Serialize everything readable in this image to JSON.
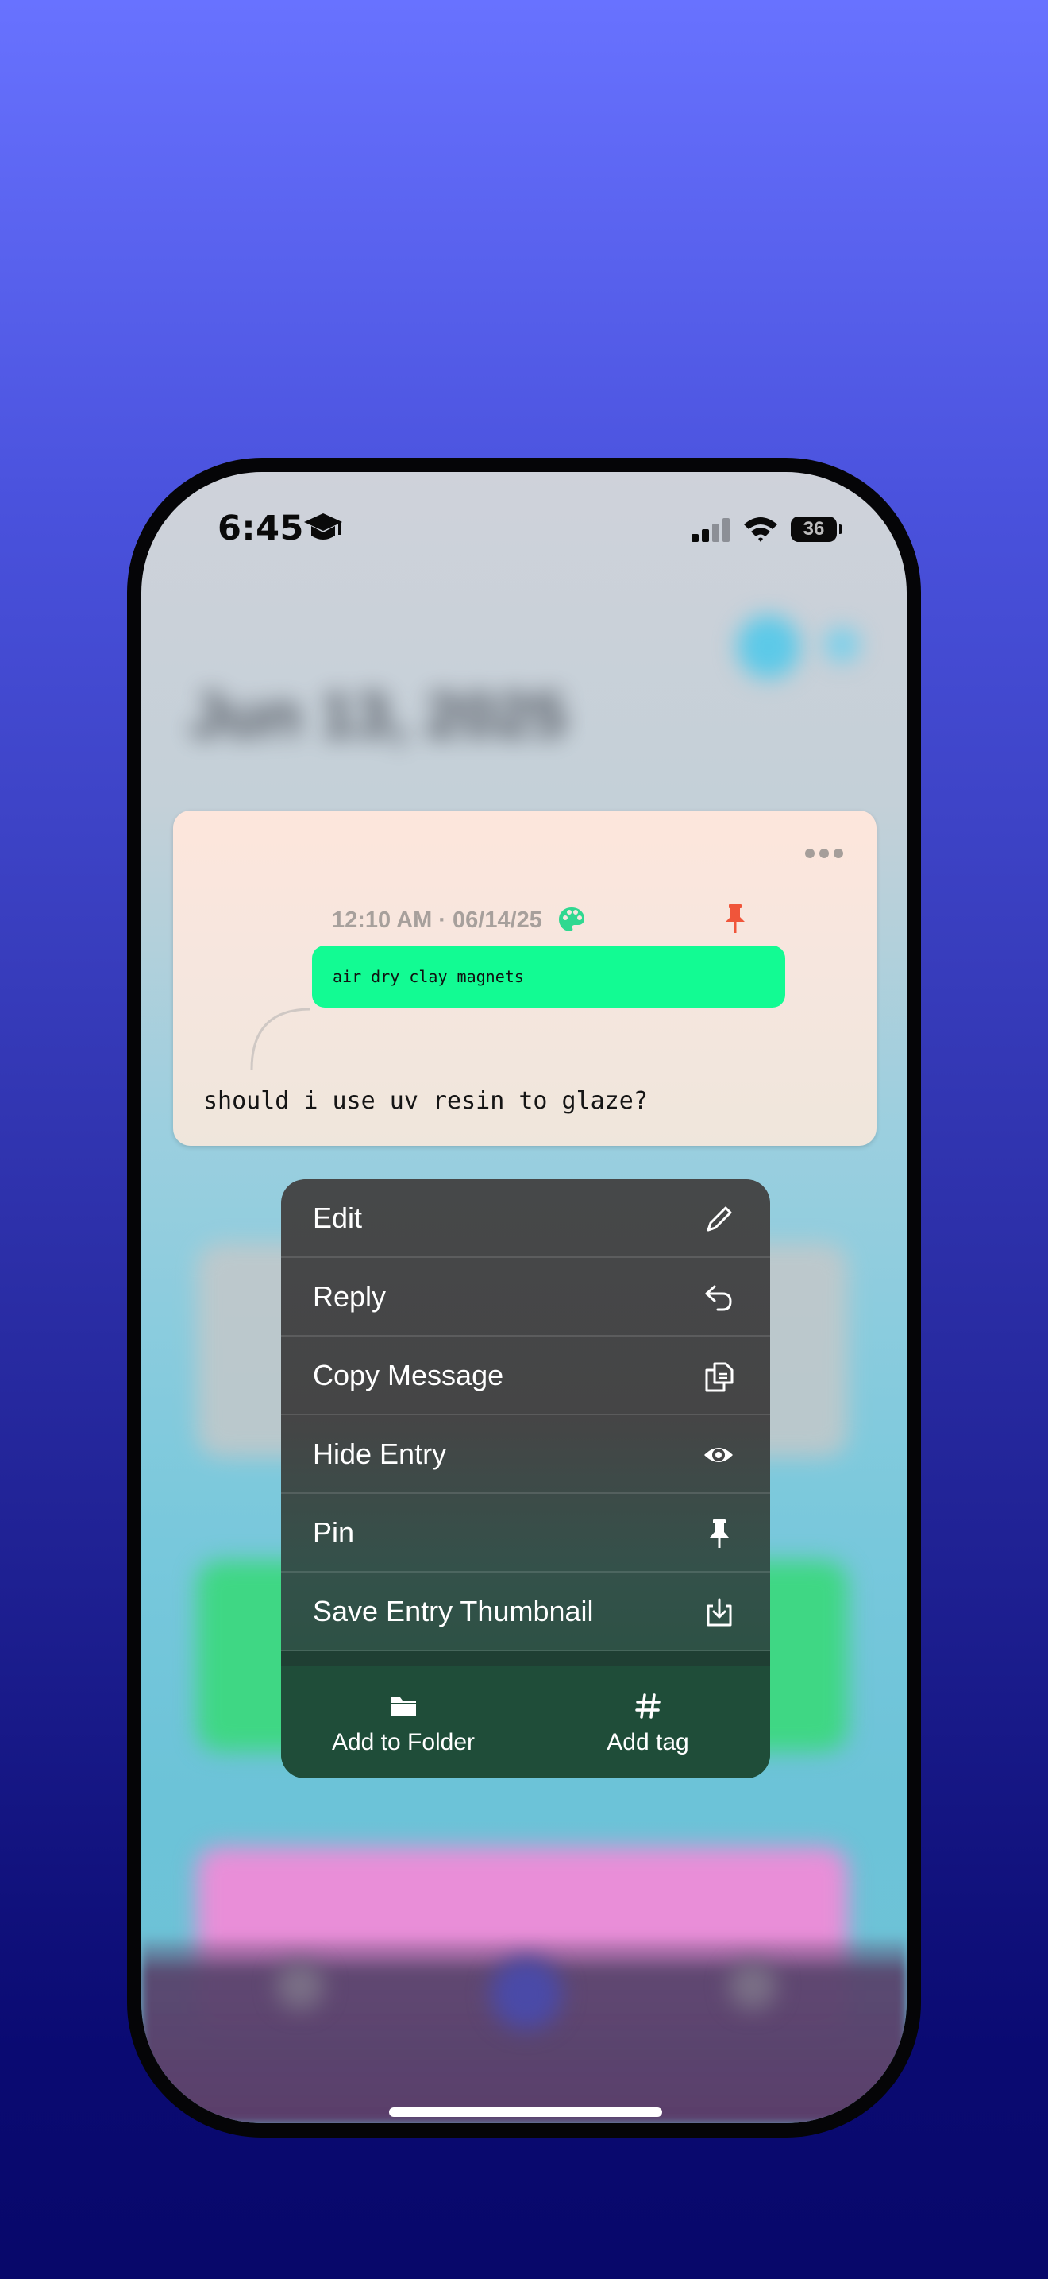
{
  "status_bar": {
    "time": "6:45",
    "battery": "36"
  },
  "background": {
    "blurred_title": "Jun 13, 2025"
  },
  "entry": {
    "meta": "12:10 AM · 06/14/25",
    "quoted_text": "air dry clay magnets",
    "text": "should i use uv resin to glaze?"
  },
  "menu": {
    "items": [
      {
        "label": "Edit",
        "icon": "pencil-icon"
      },
      {
        "label": "Reply",
        "icon": "reply-arrow-icon"
      },
      {
        "label": "Copy Message",
        "icon": "copy-docs-icon"
      },
      {
        "label": "Hide Entry",
        "icon": "eye-icon"
      },
      {
        "label": "Pin",
        "icon": "pin-icon"
      },
      {
        "label": "Save Entry Thumbnail",
        "icon": "save-download-icon"
      }
    ],
    "bottom": [
      {
        "label": "Add to Folder",
        "icon": "folder-icon"
      },
      {
        "label": "Add tag",
        "icon": "hash-icon"
      }
    ]
  },
  "colors": {
    "quote_bubble": "#12fb93",
    "pin_accent": "#f0553a",
    "palette_accent": "#2fd890"
  }
}
